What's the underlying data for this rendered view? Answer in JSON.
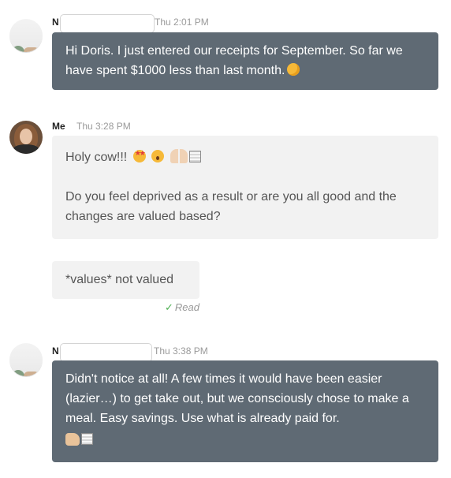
{
  "messages": [
    {
      "sender_initial": "N",
      "time": "Thu 2:01 PM",
      "text": "Hi Doris. I just entered our receipts for September. So far we have spent $1000 less than last month."
    },
    {
      "sender": "Me",
      "time": "Thu 3:28 PM",
      "line1": "Holy cow!!!",
      "line2": "Do you feel deprived as a result or are you all good and the changes are valued based?"
    },
    {
      "text": "*values* not valued",
      "status": "Read"
    },
    {
      "sender_initial": "N",
      "time": "Thu 3:38 PM",
      "text": "Didn't notice at all!  A few times it would have been easier (lazier…) to get take out, but we consciously chose to make a meal. Easy savings. Use what is already paid for."
    }
  ]
}
